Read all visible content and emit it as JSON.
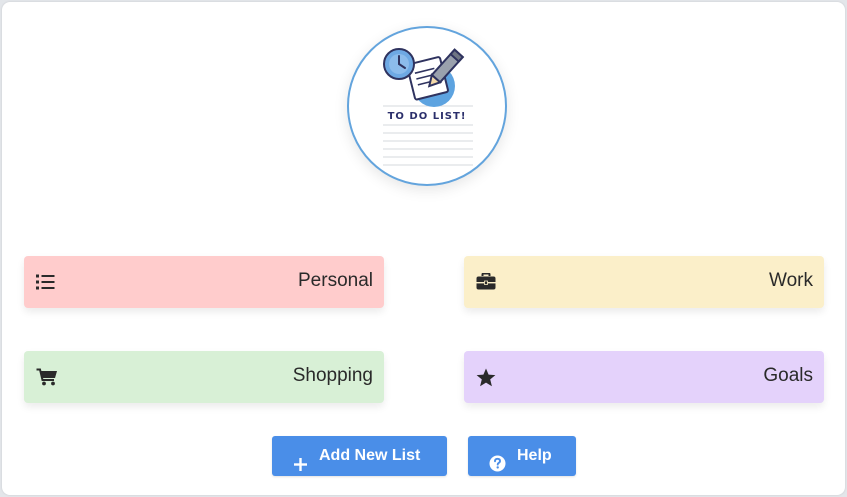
{
  "logo": {
    "title": "TO DO LIST!",
    "icon": "todo-list-logo"
  },
  "categories": [
    {
      "label": "Personal",
      "icon": "list-icon",
      "color": "#ffcccc"
    },
    {
      "label": "Work",
      "icon": "briefcase-icon",
      "color": "#fbefc9"
    },
    {
      "label": "Shopping",
      "icon": "cart-icon",
      "color": "#d8f0d6"
    },
    {
      "label": "Goals",
      "icon": "star-icon",
      "color": "#e4d2fb"
    }
  ],
  "actions": {
    "add_label": "Add New List",
    "add_icon": "plus-icon",
    "help_label": "Help",
    "help_icon": "question-circle-icon",
    "button_color": "#4a8ee8"
  }
}
